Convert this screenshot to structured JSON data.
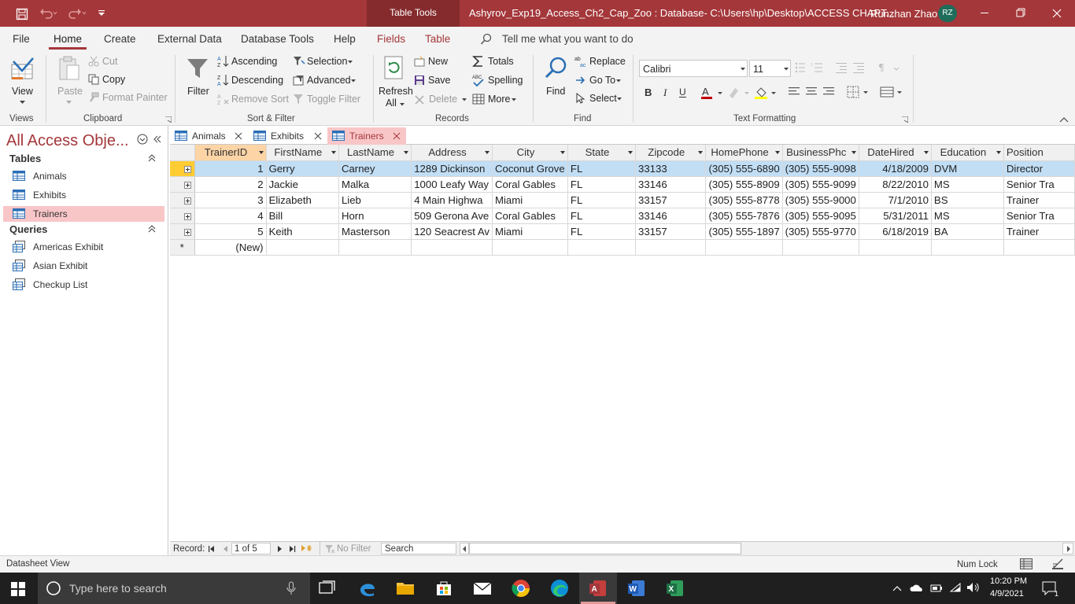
{
  "titlebar": {
    "context_tab": "Table Tools",
    "title": "Ashyrov_Exp19_Access_Ch2_Cap_Zoo : Database- C:\\Users\\hp\\Desktop\\ACCESS CHAPT...",
    "user": "Runzhan Zhao",
    "initials": "RZ"
  },
  "menu": {
    "items": [
      "File",
      "Home",
      "Create",
      "External Data",
      "Database Tools",
      "Help",
      "Fields",
      "Table"
    ],
    "tell_me": "Tell me what you want to do"
  },
  "ribbon": {
    "views": {
      "view": "View",
      "label": "Views"
    },
    "clipboard": {
      "paste": "Paste",
      "cut": "Cut",
      "copy": "Copy",
      "format_painter": "Format Painter",
      "label": "Clipboard"
    },
    "sort_filter": {
      "filter": "Filter",
      "ascending": "Ascending",
      "descending": "Descending",
      "remove_sort": "Remove Sort",
      "selection": "Selection",
      "advanced": "Advanced",
      "toggle_filter": "Toggle Filter",
      "label": "Sort & Filter"
    },
    "records": {
      "refresh": "Refresh",
      "refresh_all": "All",
      "new": "New",
      "save": "Save",
      "delete": "Delete",
      "totals": "Totals",
      "spelling": "Spelling",
      "more": "More",
      "label": "Records"
    },
    "find": {
      "find": "Find",
      "replace": "Replace",
      "goto": "Go To",
      "select": "Select",
      "label": "Find"
    },
    "text_formatting": {
      "font": "Calibri",
      "size": "11",
      "label": "Text Formatting"
    }
  },
  "nav": {
    "header": "All Access Obje...",
    "tables_label": "Tables",
    "tables": [
      "Animals",
      "Exhibits",
      "Trainers"
    ],
    "queries_label": "Queries",
    "queries": [
      "Americas Exhibit",
      "Asian Exhibit",
      "Checkup List"
    ]
  },
  "doc_tabs": [
    "Animals",
    "Exhibits",
    "Trainers"
  ],
  "datasheet": {
    "columns": [
      "TrainerID",
      "FirstName",
      "LastName",
      "Address",
      "City",
      "State",
      "Zipcode",
      "HomePhone",
      "BusinessPhc",
      "DateHired",
      "Education",
      "Position"
    ],
    "rows": [
      [
        "1",
        "Gerry",
        "Carney",
        "1289 Dickinson",
        "Coconut Grove",
        "FL",
        "33133",
        "(305) 555-6890",
        "(305) 555-9098",
        "4/18/2009",
        "DVM",
        "Director"
      ],
      [
        "2",
        "Jackie",
        "Malka",
        "1000 Leafy Way",
        "Coral Gables",
        "FL",
        "33146",
        "(305) 555-8909",
        "(305) 555-9099",
        "8/22/2010",
        "MS",
        "Senior Tra"
      ],
      [
        "3",
        "Elizabeth",
        "Lieb",
        "4 Main Highwa",
        "Miami",
        "FL",
        "33157",
        "(305) 555-8778",
        "(305) 555-9000",
        "7/1/2010",
        "BS",
        "Trainer"
      ],
      [
        "4",
        "Bill",
        "Horn",
        "509 Gerona Ave",
        "Coral Gables",
        "FL",
        "33146",
        "(305) 555-7876",
        "(305) 555-9095",
        "5/31/2011",
        "MS",
        "Senior Tra"
      ],
      [
        "5",
        "Keith",
        "Masterson",
        "120 Seacrest Av",
        "Miami",
        "FL",
        "33157",
        "(305) 555-1897",
        "(305) 555-9770",
        "6/18/2019",
        "BA",
        "Trainer"
      ]
    ],
    "new_row": "(New)"
  },
  "record_nav": {
    "label": "Record:",
    "position": "1 of 5",
    "filter": "No Filter",
    "search": "Search"
  },
  "status": {
    "left": "Datasheet View",
    "numlock": "Num Lock"
  },
  "taskbar": {
    "search_placeholder": "Type here to search",
    "time": "10:20 PM",
    "date": "4/9/2021",
    "notifications": "1"
  },
  "colors": {
    "brand": "#a4373a",
    "selection_row": "#c1def5",
    "key_header": "#fdd4a6",
    "nav_selected": "#f9c6c8"
  }
}
